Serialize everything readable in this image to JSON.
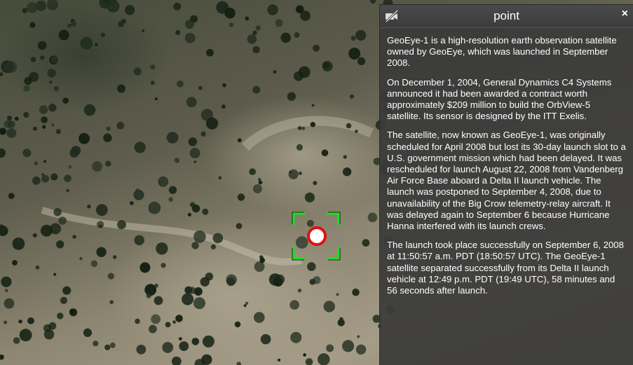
{
  "infobox": {
    "title": "point",
    "close_symbol": "×",
    "paragraphs": [
      "GeoEye-1 is a high-resolution earth observation satellite owned by GeoEye, which was launched in September 2008.",
      "On December 1, 2004, General Dynamics C4 Systems announced it had been awarded a contract worth approximately $209 million to build the OrbView-5 satellite. Its sensor is designed by the ITT Exelis.",
      "The satellite, now known as GeoEye-1, was originally scheduled for April 2008 but lost its 30-day launch slot to a U.S. government mission which had been delayed. It was rescheduled for launch August 22, 2008 from Vandenberg Air Force Base aboard a Delta II launch vehicle. The launch was postponed to September 4, 2008, due to unavailability of the Big Crow telemetry-relay aircraft. It was delayed again to September 6 because Hurricane Hanna interfered with its launch crews.",
      "The launch took place successfully on September 6, 2008 at 11:50:57 a.m. PDT (18:50:57 UTC). The GeoEye-1 satellite separated successfully from its Delta II launch vehicle at 12:49 p.m. PDT (19:49 UTC), 58 minutes and 56 seconds after launch."
    ]
  },
  "icons": {
    "camera": "camera-off-icon",
    "close": "close-icon",
    "marker": "point-marker-icon",
    "selection": "selection-brackets-icon"
  },
  "colors": {
    "panel_bg": "#3a3a3a",
    "marker_fill": "#ffffff",
    "marker_stroke": "#e01010",
    "selection": "#22dd22"
  }
}
